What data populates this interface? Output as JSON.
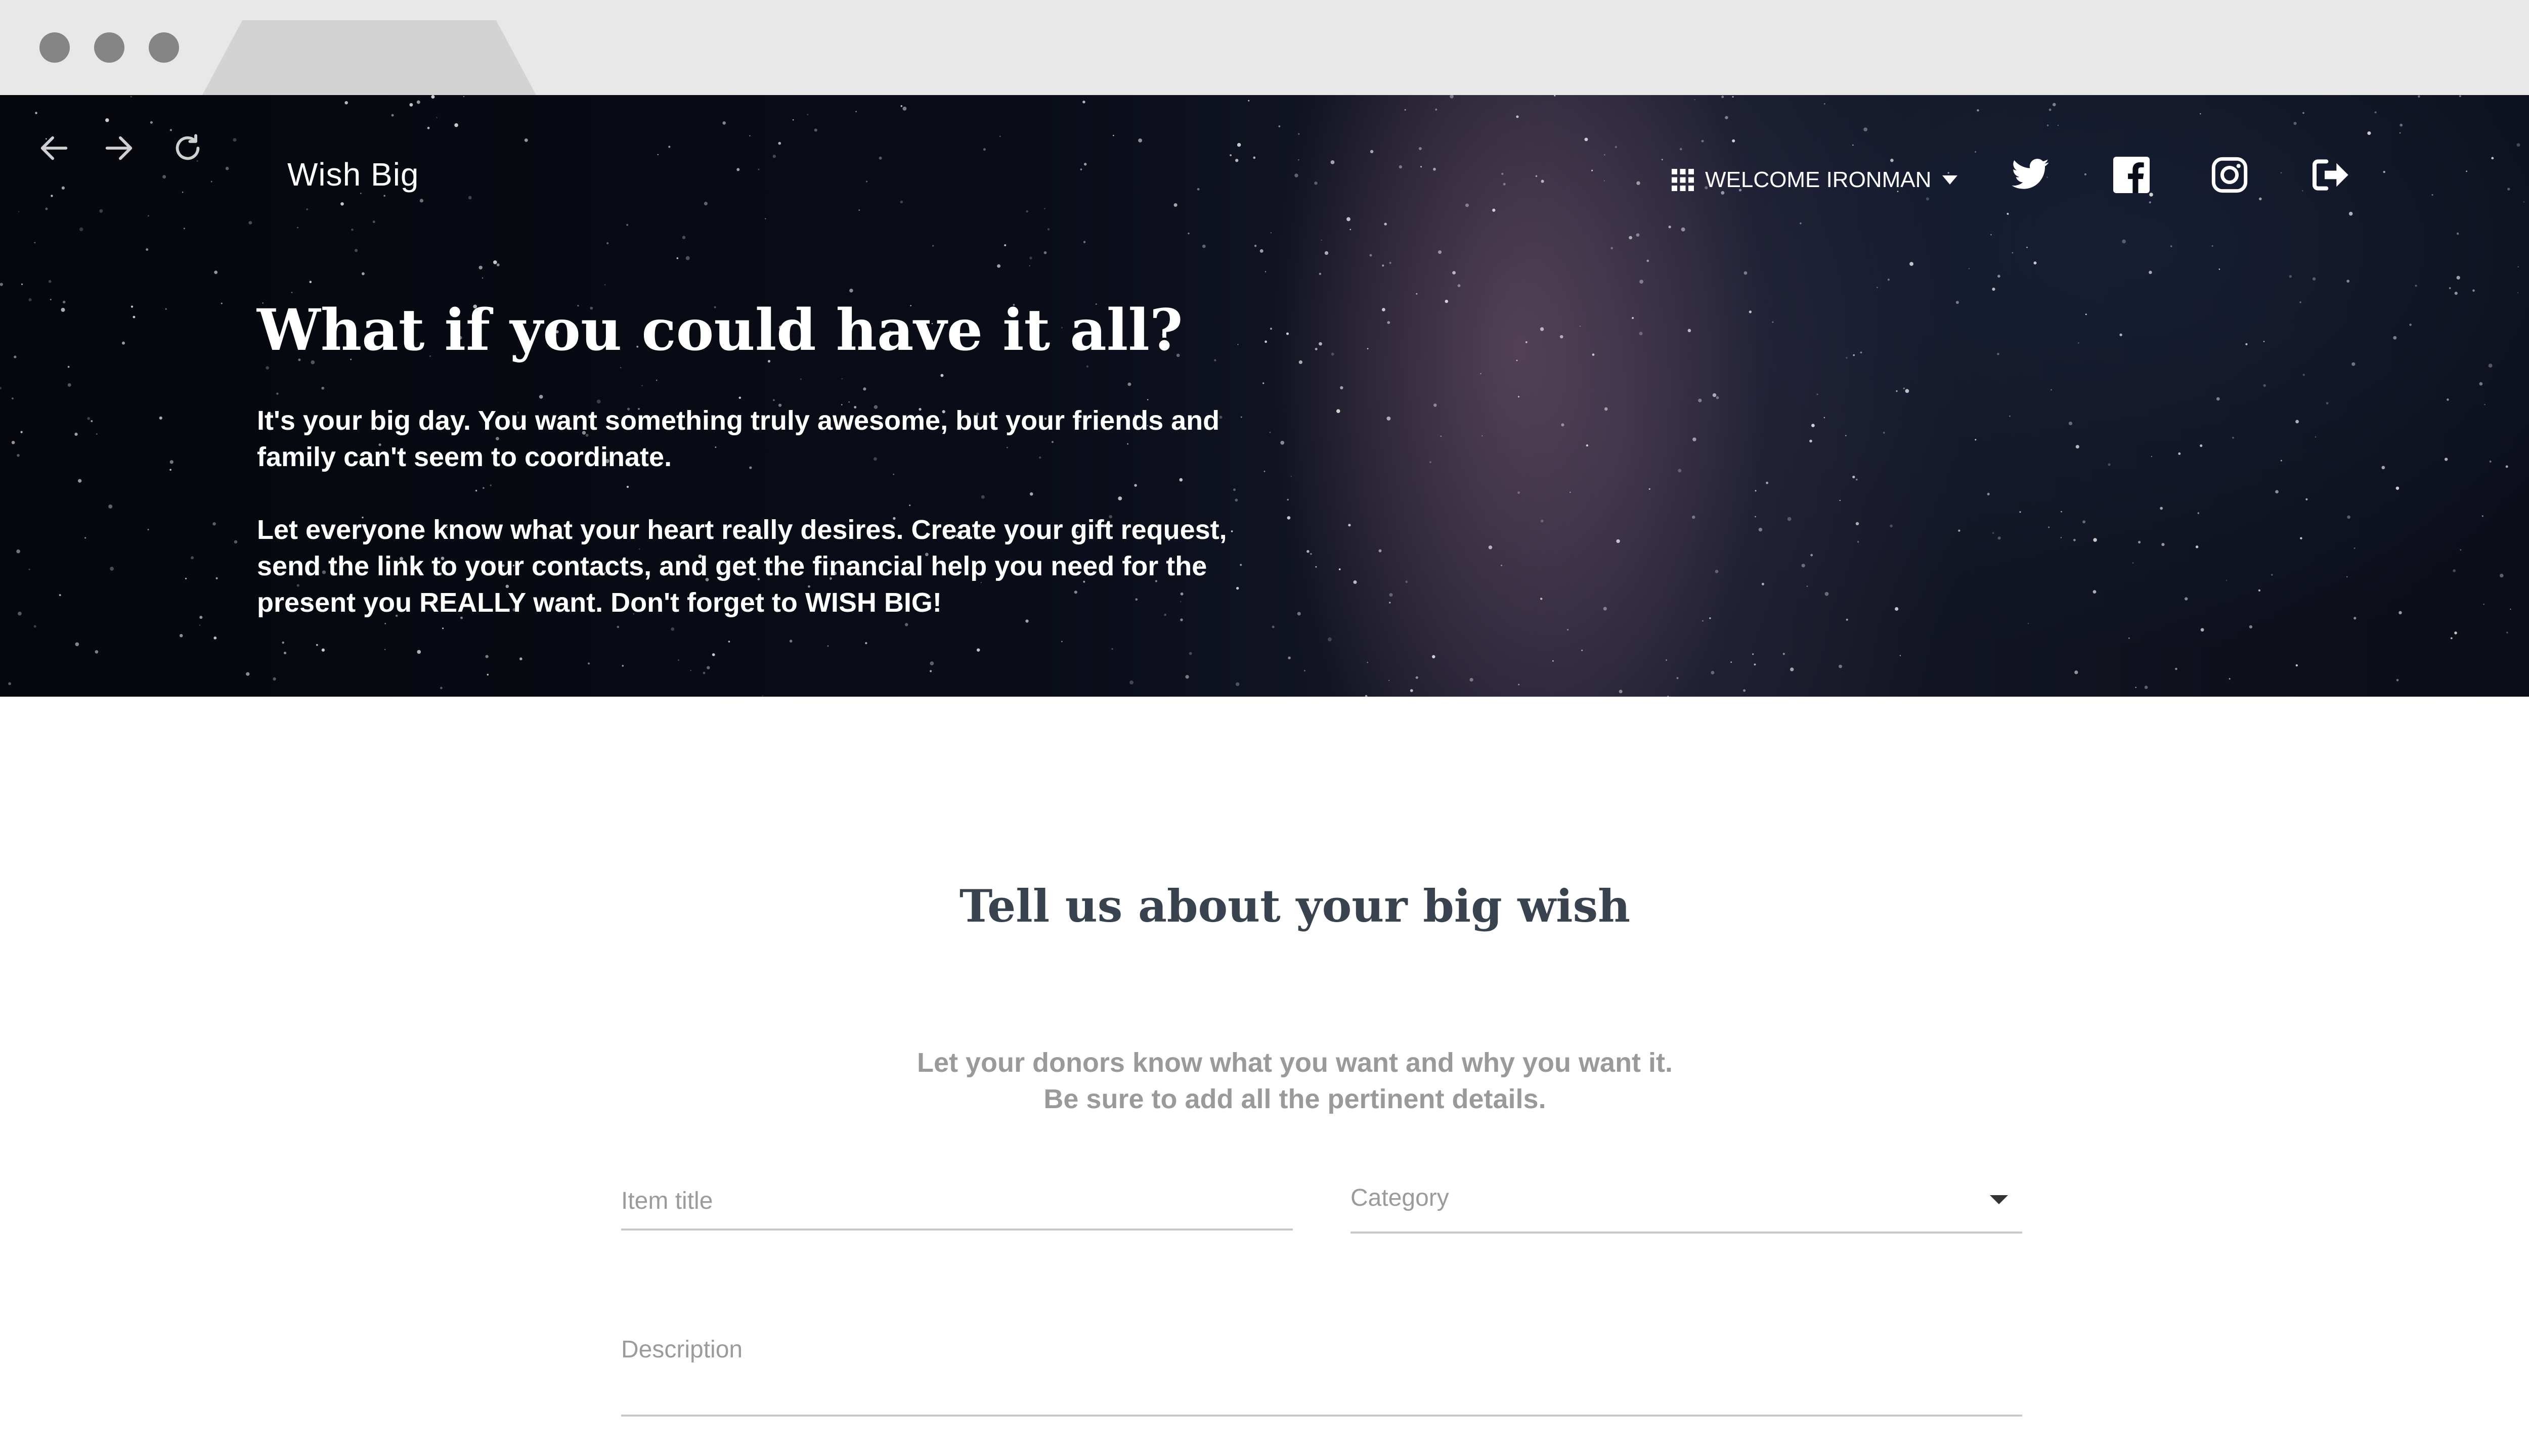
{
  "brand": {
    "name": "Wish Big"
  },
  "header": {
    "welcome_label": "WELCOME IRONMAN"
  },
  "hero": {
    "title": "What if you could have it all?",
    "paragraph_1_line_1": "It's your big day. You want something truly awesome, but your friends and",
    "paragraph_1_line_2": "family can't seem to coordinate.",
    "paragraph_2_line_1": "Let everyone know what your heart really desires. Create your gift request,",
    "paragraph_2_line_2": "send the link to your contacts, and get the financial help you need for the",
    "paragraph_2_line_3": "present you REALLY want. Don't forget to WISH BIG!"
  },
  "form": {
    "title": "Tell us about your big wish",
    "subtitle_line_1": "Let your donors know what you want and why you want it.",
    "subtitle_line_2": "Be sure to add all the pertinent details.",
    "item_title_placeholder": "Item title",
    "category_placeholder": "Category",
    "description_placeholder": "Description"
  },
  "colors": {
    "hero_text": "#ffffff",
    "section_title": "#39434f",
    "muted_text": "#9a9a9a",
    "field_border": "#c9c9c9"
  },
  "icons": {
    "back": "arrow-left-icon",
    "forward": "arrow-right-icon",
    "reload": "reload-icon",
    "apps": "apps-grid-icon",
    "dropdown": "caret-down-icon",
    "twitter": "twitter-icon",
    "facebook": "facebook-icon",
    "instagram": "instagram-icon",
    "logout": "logout-icon"
  }
}
